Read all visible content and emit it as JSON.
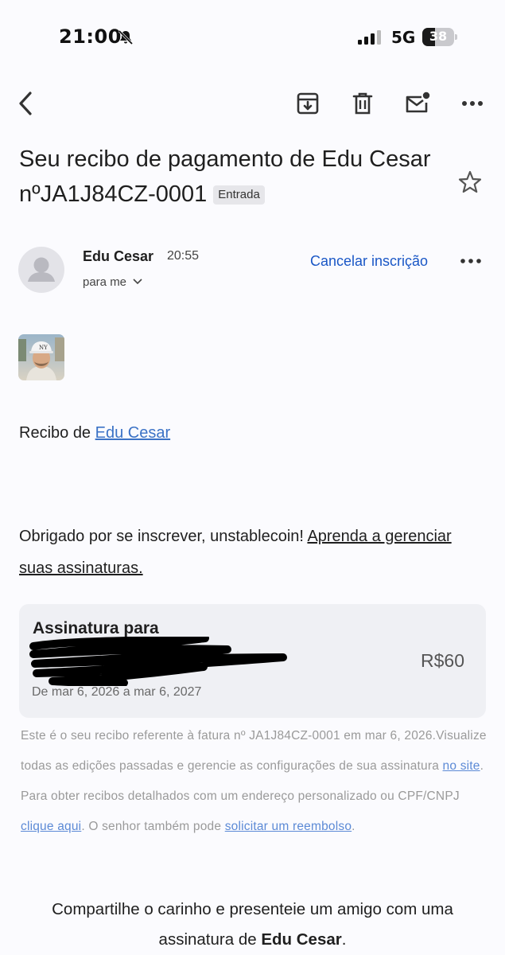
{
  "status_bar": {
    "time": "21:00",
    "network": "5G",
    "battery": "38"
  },
  "toolbar": {
    "back_icon": "chevron-left-icon",
    "archive_icon": "archive-icon",
    "delete_icon": "trash-icon",
    "mark_unread_icon": "mail-unread-icon",
    "more_icon": "more-horizontal-icon"
  },
  "email": {
    "subject": "Seu recibo de pagamento de Edu Cesar nºJA1J84CZ-0001",
    "label": "Entrada",
    "sender_name": "Edu Cesar",
    "sent_time": "20:55",
    "recipient": "para me",
    "unsubscribe": "Cancelar inscrição"
  },
  "body": {
    "receipt_prefix": "Recibo de ",
    "receipt_author": "Edu Cesar",
    "thanks_text": "Obrigado por se inscrever, unstablecoin! ",
    "thanks_link": "Aprenda a gerenciar suas assinaturas.",
    "card": {
      "title": "Assinatura para",
      "price": "R$60",
      "period": "De mar 6, 2026 a mar 6, 2027"
    },
    "fine_print": {
      "part1": "Este é o seu recibo referente à fatura nº JA1J84CZ-0001 em mar 6, 2026.Visualize todas as edições passadas e gerencie as configurações de sua assinatura ",
      "link1": "no site",
      "part2": ". Para obter recibos detalhados com um endereço personalizado ou CPF/CNPJ ",
      "link2": "clique aqui",
      "part3": ". O senhor também pode ",
      "link3": "solicitar um reembolso",
      "part4": "."
    },
    "share": {
      "text": "Compartilhe o carinho e presenteie um amigo com uma assinatura de ",
      "name": "Edu Cesar",
      "end": "."
    }
  },
  "colors": {
    "link": "#3b72c6",
    "unsubscribe": "#1a57c6",
    "card_bg": "#eff0f4"
  }
}
